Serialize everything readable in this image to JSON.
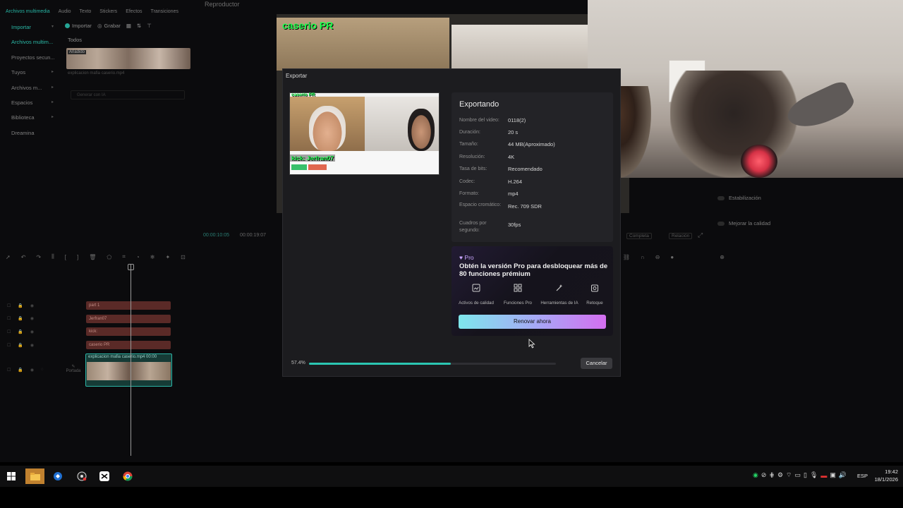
{
  "editor": {
    "top_tabs": [
      "Archivos multimedia",
      "Audio",
      "Texto",
      "Stickers",
      "Efectos",
      "Transiciones"
    ],
    "player_title": "Reproductor",
    "sidebar": [
      "Importar",
      "Archivos multim...",
      "Proyectos secun...",
      "Tuyos",
      "Archivos m...",
      "Espacios",
      "Biblioteca",
      "Dreamina"
    ],
    "media_toolbar": {
      "import": "Importar",
      "record": "Grabar"
    },
    "filter_all": "Todos",
    "thumb_badge": "Añadido",
    "media_filename": "explicacion mafia caserio.mp4",
    "ai_generate": "Generar con IA",
    "player_overlay_text": "caserio PR",
    "time_current": "00:00:10:05",
    "time_total": "00:00:19:07",
    "stabilization": "Estabilización",
    "improve_quality": "Mejorar la calidad",
    "view_complete": "Completa",
    "view_ratio": "Relación",
    "tracks": [
      "part 1",
      "Jerfran07",
      "kick:",
      "caserio PR"
    ],
    "main_clip_label": "explicacion mafia caserio.mp4 00:00",
    "cover_label": "Portada"
  },
  "dialog": {
    "title": "Exportar",
    "preview_overlay": "caserio PR",
    "preview_kick": "kick: Jerfran07",
    "heading": "Exportando",
    "fields": [
      {
        "label": "Nombre del video:",
        "value": "0118(2)"
      },
      {
        "label": "Duración:",
        "value": "20 s"
      },
      {
        "label": "Tamaño:",
        "value": "44 MB(Aproximado)"
      },
      {
        "label": "Resolución:",
        "value": "4K"
      },
      {
        "label": "Tasa de bits:",
        "value": "Recomendado"
      },
      {
        "label": "Codec:",
        "value": "H.264"
      },
      {
        "label": "Formato:",
        "value": "mp4"
      },
      {
        "label": "Espacio cromático:",
        "value": "Rec. 709 SDR"
      },
      {
        "label": "Cuadros por segundo:",
        "value": "30fps"
      }
    ],
    "pro": {
      "tag": "Pro",
      "headline": "Obtén la versión Pro para desbloquear más de 80 funciones prémium",
      "features": [
        {
          "icon": "quality-assets-icon",
          "label": "Activos de calidad"
        },
        {
          "icon": "pro-functions-icon",
          "label": "Funciones Pro"
        },
        {
          "icon": "ai-tools-icon",
          "label": "Herramientas de IA"
        },
        {
          "icon": "retouch-icon",
          "label": "Retoque"
        }
      ],
      "renew_button": "Renovar ahora"
    },
    "progress": {
      "label": "57.4%",
      "value": 0.574
    },
    "cancel_button": "Cancelar"
  },
  "taskbar": {
    "language": "ESP",
    "time": "19:42",
    "date": "18/1/2026"
  },
  "colors": {
    "accent_teal": "#2bc6b2",
    "dialog_bg": "#1c1c1f",
    "overlay_green": "#1aff4c"
  }
}
